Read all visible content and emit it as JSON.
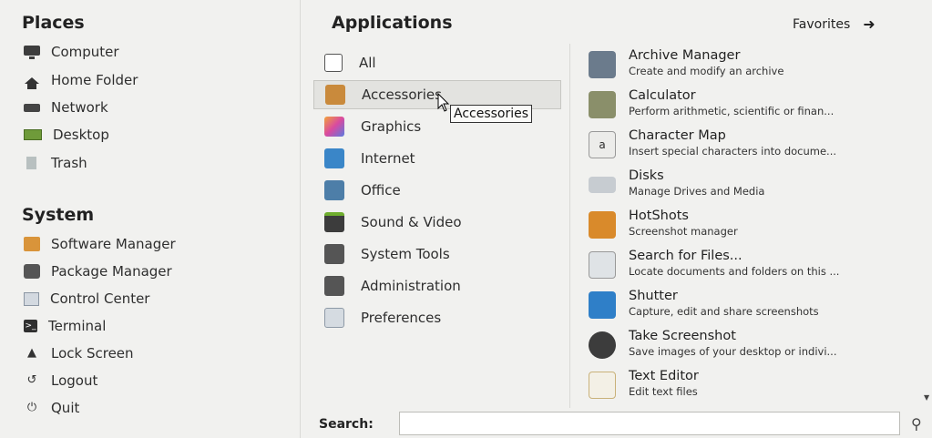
{
  "places": {
    "title": "Places",
    "items": [
      {
        "label": "Computer",
        "icon": "computer-icon"
      },
      {
        "label": "Home Folder",
        "icon": "home-folder-icon"
      },
      {
        "label": "Network",
        "icon": "network-icon"
      },
      {
        "label": "Desktop",
        "icon": "desktop-icon"
      },
      {
        "label": "Trash",
        "icon": "trash-icon"
      }
    ]
  },
  "system": {
    "title": "System",
    "items": [
      {
        "label": "Software Manager",
        "icon": "software-manager-icon"
      },
      {
        "label": "Package Manager",
        "icon": "package-manager-icon"
      },
      {
        "label": "Control Center",
        "icon": "control-center-icon"
      },
      {
        "label": "Terminal",
        "icon": "terminal-icon"
      },
      {
        "label": "Lock Screen",
        "icon": "lock-icon"
      },
      {
        "label": "Logout",
        "icon": "logout-icon"
      },
      {
        "label": "Quit",
        "icon": "power-icon"
      }
    ]
  },
  "applications": {
    "title": "Applications",
    "favorites_label": "Favorites",
    "categories": [
      {
        "label": "All",
        "color": "#ffffff"
      },
      {
        "label": "Accessories",
        "color": "#c98a3c"
      },
      {
        "label": "Graphics",
        "color": "#d94aa0"
      },
      {
        "label": "Internet",
        "color": "#3a86c8"
      },
      {
        "label": "Office",
        "color": "#4d7ea8"
      },
      {
        "label": "Sound & Video",
        "color": "#3c3c3c"
      },
      {
        "label": "System Tools",
        "color": "#555555"
      },
      {
        "label": "Administration",
        "color": "#555555"
      },
      {
        "label": "Preferences",
        "color": "#b8c4cf"
      }
    ],
    "active_category": "Accessories",
    "tooltip": "Accessories",
    "apps": [
      {
        "name": "Archive Manager",
        "desc": "Create and modify an archive",
        "icon": "archive-manager-icon",
        "color": "#6b7b8c"
      },
      {
        "name": "Calculator",
        "desc": "Perform arithmetic, scientific or finan...",
        "icon": "calculator-icon",
        "color": "#8a8f6a"
      },
      {
        "name": "Character Map",
        "desc": "Insert special characters into docume...",
        "icon": "character-map-icon",
        "color": "#e8e8e8"
      },
      {
        "name": "Disks",
        "desc": "Manage Drives and Media",
        "icon": "disks-icon",
        "color": "#c7ccd1"
      },
      {
        "name": "HotShots",
        "desc": "Screenshot manager",
        "icon": "hotshots-icon",
        "color": "#d98a2b"
      },
      {
        "name": "Search for Files...",
        "desc": "Locate documents and folders on this ...",
        "icon": "search-files-icon",
        "color": "#dfe3e6"
      },
      {
        "name": "Shutter",
        "desc": "Capture, edit and share screenshots",
        "icon": "shutter-icon",
        "color": "#2f7fc8"
      },
      {
        "name": "Take Screenshot",
        "desc": "Save images of your desktop or indivi...",
        "icon": "camera-icon",
        "color": "#3c3c3c"
      },
      {
        "name": "Text Editor",
        "desc": "Edit text files",
        "icon": "text-editor-icon",
        "color": "#e9c36a"
      }
    ]
  },
  "search": {
    "label": "Search:",
    "value": "",
    "placeholder": ""
  }
}
